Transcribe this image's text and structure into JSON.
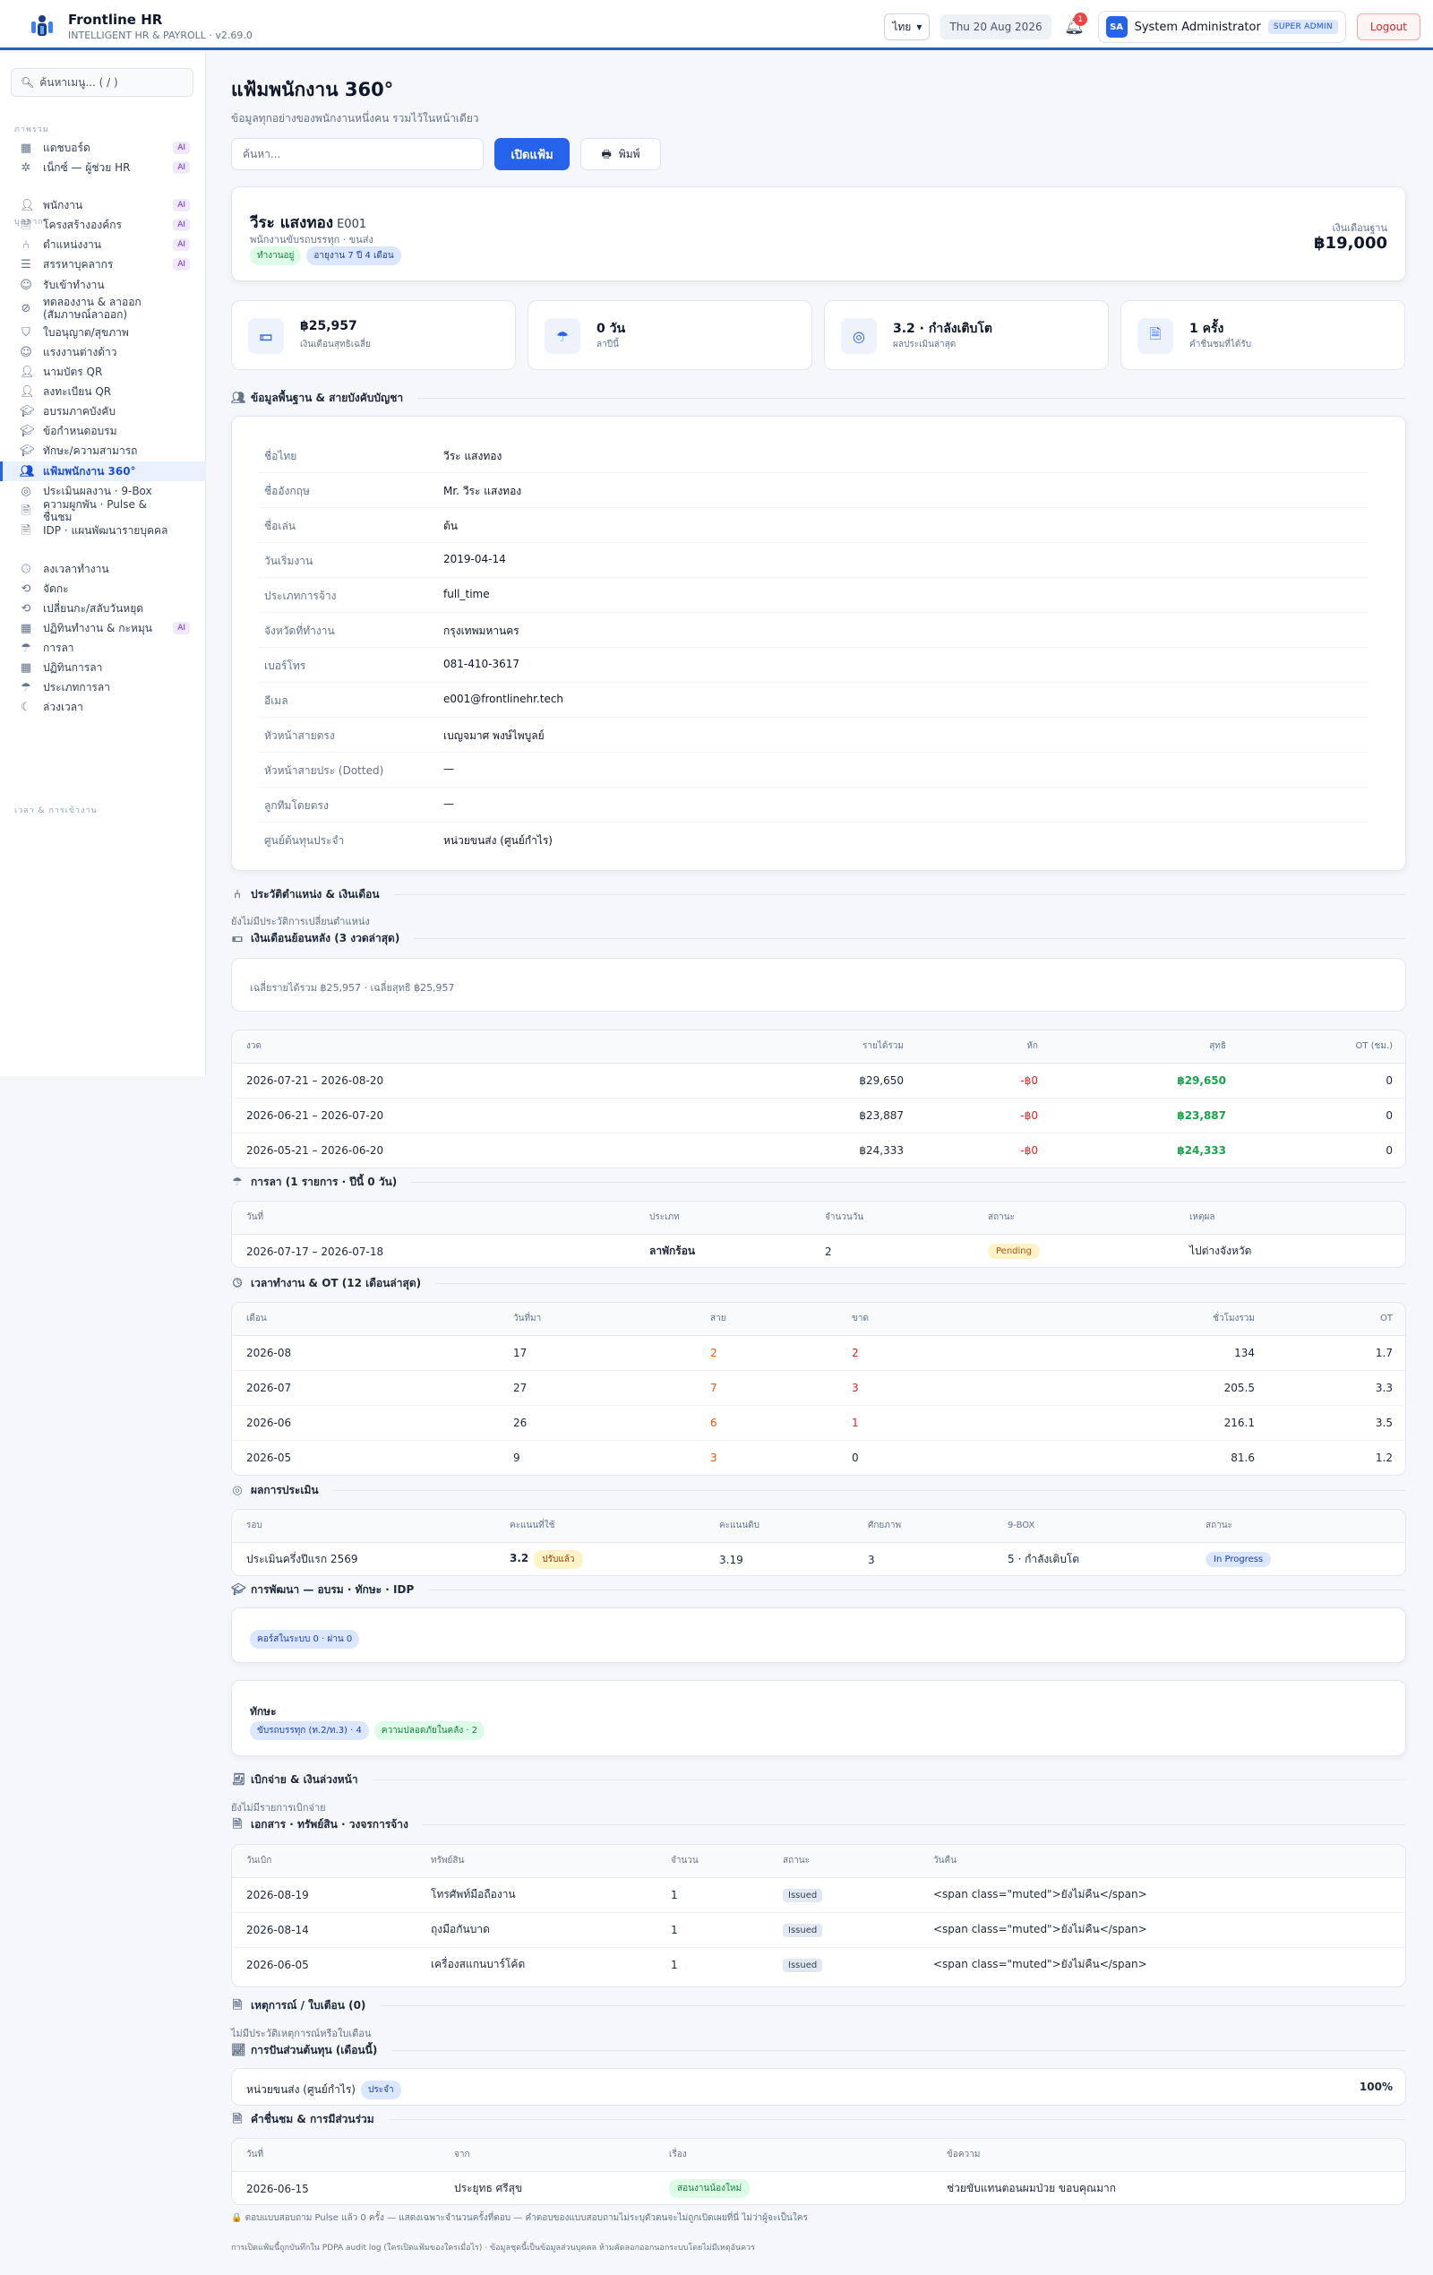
{
  "topbar": {
    "brand_name": "Frontline HR",
    "brand_sub": "INTELLIGENT HR & PAYROLL · v2.69.0",
    "lang": "ไทย",
    "date": "Thu 20 Aug 2026",
    "notif_count": "1",
    "avatar": "SA",
    "user": "System Administrator",
    "role": "SUPER ADMIN",
    "logout": "Logout"
  },
  "sidebar": {
    "search": "ค้นหาเมนู... ( / )",
    "groups": [
      "ภาพรวม",
      "บุคลากร",
      "เวลา & การเข้างาน"
    ],
    "items": [
      {
        "label": "แดชบอร์ด",
        "ai": "AI"
      },
      {
        "label": "เน็กซ์ — ผู้ช่วย HR",
        "ai": "AI"
      },
      {
        "label": "พนักงาน",
        "ai": "AI"
      },
      {
        "label": "โครงสร้างองค์กร",
        "ai": "AI"
      },
      {
        "label": "ตำแหน่งงาน",
        "ai": "AI"
      },
      {
        "label": "สรรหาบุคลากร",
        "ai": "AI"
      },
      {
        "label": "รับเข้าทำงาน"
      },
      {
        "label": "ทดลองงาน & ลาออก (สัมภาษณ์ลาออก)"
      },
      {
        "label": "ใบอนุญาต/สุขภาพ"
      },
      {
        "label": "แรงงานต่างด้าว"
      },
      {
        "label": "นามบัตร QR"
      },
      {
        "label": "ลงทะเบียน QR"
      },
      {
        "label": "อบรมภาคบังคับ"
      },
      {
        "label": "ข้อกำหนดอบรม"
      },
      {
        "label": "ทักษะ/ความสามารถ"
      },
      {
        "label": "แฟ้มพนักงาน 360°"
      },
      {
        "label": "ประเมินผลงาน · 9-Box"
      },
      {
        "label": "ความผูกพัน · Pulse & ชื่นชม"
      },
      {
        "label": "IDP · แผนพัฒนารายบุคคล"
      },
      {
        "label": "ลงเวลาทำงาน"
      },
      {
        "label": "จัดกะ"
      },
      {
        "label": "เปลี่ยนกะ/สลับวันหยุด"
      },
      {
        "label": "ปฏิทินทำงาน & กะหมุน",
        "ai": "AI"
      },
      {
        "label": "การลา"
      },
      {
        "label": "ปฏิทินการลา"
      },
      {
        "label": "ประเภทการลา"
      },
      {
        "label": "ล่วงเวลา"
      }
    ]
  },
  "page": {
    "title": "แฟ้มพนักงาน 360°",
    "subtitle": "ข้อมูลทุกอย่างของพนักงานหนึ่งคน รวมไว้ในหน้าเดียว",
    "search_placeholder": "ค้นหา...",
    "open_btn": "เปิดแฟ้ม",
    "print_btn": "พิมพ์"
  },
  "profile": {
    "name": "วีระ แสงทอง",
    "code": "E001",
    "position": "พนักงานขับรถบรรทุก · ขนส่ง",
    "status": "ทำงานอยู่",
    "tenure": "อายุงาน 7 ปี 4 เดือน",
    "salary_label": "เงินเดือนฐาน",
    "salary": "฿19,000"
  },
  "kpis": [
    {
      "value": "฿25,957",
      "label": "เงินเดือนสุทธิเฉลี่ย",
      "icon": "money-icon"
    },
    {
      "value": "0 วัน",
      "label": "ลาปีนี้",
      "icon": "umbrella-icon"
    },
    {
      "value": "3.2 · กำลังเติบโต",
      "label": "ผลประเมินล่าสุด",
      "icon": "target-icon"
    },
    {
      "value": "1 ครั้ง",
      "label": "คำชื่นชมที่ได้รับ",
      "icon": "document-icon"
    }
  ],
  "basic": {
    "heading": "ข้อมูลพื้นฐาน & สายบังคับบัญชา",
    "rows": [
      {
        "k": "ชื่อไทย",
        "v": "วีระ แสงทอง"
      },
      {
        "k": "ชื่ออังกฤษ",
        "v": "Mr. วีระ แสงทอง"
      },
      {
        "k": "ชื่อเล่น",
        "v": "ต้น"
      },
      {
        "k": "วันเริ่มงาน",
        "v": "2019-04-14"
      },
      {
        "k": "ประเภทการจ้าง",
        "v": "full_time"
      },
      {
        "k": "จังหวัดที่ทำงาน",
        "v": "กรุงเทพมหานคร"
      },
      {
        "k": "เบอร์โทร",
        "v": "081-410-3617"
      },
      {
        "k": "อีเมล",
        "v": "e001@frontlinehr.tech"
      },
      {
        "k": "หัวหน้าสายตรง",
        "v": "เบญจมาศ พงษ์ไพบูลย์"
      },
      {
        "k": "หัวหน้าสายประ (Dotted)",
        "v": "—"
      },
      {
        "k": "ลูกทีมโดยตรง",
        "v": "—"
      },
      {
        "k": "ศูนย์ต้นทุนประจำ",
        "v": "หน่วยขนส่ง (ศูนย์กำไร)"
      }
    ]
  },
  "position_history": {
    "heading": "ประวัติตำแหน่ง & เงินเดือน",
    "empty": "ยังไม่มีประวัติการเปลี่ยนตำแหน่ง"
  },
  "payroll": {
    "heading": "เงินเดือนย้อนหลัง (3 งวดล่าสุด)",
    "summary": "เฉลี่ยรายได้รวม ฿25,957 · เฉลี่ยสุทธิ ฿25,957",
    "cols": [
      "งวด",
      "รายได้รวม",
      "หัก",
      "สุทธิ",
      "OT (ชม.)"
    ],
    "rows": [
      {
        "period": "2026-07-21 – 2026-08-20",
        "gross": "฿29,650",
        "ded": "-฿0",
        "net": "฿29,650",
        "ot": "0"
      },
      {
        "period": "2026-06-21 – 2026-07-20",
        "gross": "฿23,887",
        "ded": "-฿0",
        "net": "฿23,887",
        "ot": "0"
      },
      {
        "period": "2026-05-21 – 2026-06-20",
        "gross": "฿24,333",
        "ded": "-฿0",
        "net": "฿24,333",
        "ot": "0"
      }
    ]
  },
  "leave": {
    "heading": "การลา (1 รายการ · ปีนี้ 0 วัน)",
    "cols": [
      "วันที่",
      "ประเภท",
      "จำนวนวัน",
      "สถานะ",
      "เหตุผล"
    ],
    "rows": [
      {
        "date": "2026-07-17 – 2026-07-18",
        "type": "ลาพักร้อน",
        "days": "2",
        "status": "Pending",
        "reason": "ไปต่างจังหวัด"
      }
    ]
  },
  "attendance": {
    "heading": "เวลาทำงาน & OT (12 เดือนล่าสุด)",
    "cols": [
      "เดือน",
      "วันที่มา",
      "สาย",
      "ขาด",
      "ชั่วโมงรวม",
      "OT"
    ],
    "rows": [
      {
        "m": "2026-08",
        "days": "17",
        "late": "2",
        "absent": "2",
        "hours": "134",
        "ot": "1.7"
      },
      {
        "m": "2026-07",
        "days": "27",
        "late": "7",
        "absent": "3",
        "hours": "205.5",
        "ot": "3.3"
      },
      {
        "m": "2026-06",
        "days": "26",
        "late": "6",
        "absent": "1",
        "hours": "216.1",
        "ot": "3.5"
      },
      {
        "m": "2026-05",
        "days": "9",
        "late": "3",
        "absent": "0",
        "hours": "81.6",
        "ot": "1.2"
      }
    ]
  },
  "evaluation": {
    "heading": "ผลการประเมิน",
    "cols": [
      "รอบ",
      "คะแนนที่ใช้",
      "คะแนนดิบ",
      "ศักยภาพ",
      "9-BOX",
      "สถานะ"
    ],
    "rows": [
      {
        "round": "ประเมินครึ่งปีแรก 2569",
        "score": "3.2",
        "adj": "ปรับแล้ว",
        "raw": "3.19",
        "pot": "3",
        "box": "5 · กำลังเติบโต",
        "status": "In Progress"
      }
    ]
  },
  "development": {
    "heading": "การพัฒนา — อบรม · ทักษะ · IDP",
    "courses": "คอร์สในระบบ 0 · ผ่าน 0",
    "skills_title": "ทักษะ",
    "skills": [
      "ขับรถบรรทุก (ท.2/ท.3) · 4",
      "ความปลอดภัยในคลัง · 2"
    ]
  },
  "expense": {
    "heading": "เบิกจ่าย & เงินล่วงหน้า",
    "empty": "ยังไม่มีรายการเบิกจ่าย"
  },
  "assets": {
    "heading": "เอกสาร · ทรัพย์สิน · วงจรการจ้าง",
    "cols": [
      "วันเบิก",
      "ทรัพย์สิน",
      "จำนวน",
      "สถานะ",
      "วันคืน"
    ],
    "rows": [
      {
        "date": "2026-08-19",
        "asset": "โทรศัพท์มือถืองาน",
        "qty": "1",
        "status": "Issued",
        "ret": "<span class=\"muted\">ยังไม่คืน</span>"
      },
      {
        "date": "2026-08-14",
        "asset": "ถุงมือกันบาด",
        "qty": "1",
        "status": "Issued",
        "ret": "<span class=\"muted\">ยังไม่คืน</span>"
      },
      {
        "date": "2026-06-05",
        "asset": "เครื่องสแกนบาร์โค้ด",
        "qty": "1",
        "status": "Issued",
        "ret": "<span class=\"muted\">ยังไม่คืน</span>"
      }
    ]
  },
  "incidents": {
    "heading": "เหตุการณ์ / ใบเตือน (0)",
    "empty": "ไม่มีประวัติเหตุการณ์หรือใบเตือน"
  },
  "cost": {
    "heading": "การปันส่วนต้นทุน (เดือนนี้)",
    "unit": "หน่วยขนส่ง (ศูนย์กำไร)",
    "tag": "ประจำ",
    "pct": "100%"
  },
  "praise": {
    "heading": "คำชื่นชม & การมีส่วนร่วม",
    "cols": [
      "วันที่",
      "จาก",
      "เรื่อง",
      "ข้อความ"
    ],
    "rows": [
      {
        "date": "2026-06-15",
        "from": "ประยุทธ ศรีสุข",
        "topic": "สอนงานน้องใหม่",
        "msg": "ช่วยขับแทนตอนผมป่วย ขอบคุณมาก"
      }
    ]
  },
  "footer": {
    "pulse": "🔒 ตอบแบบสอบถาม Pulse แล้ว 0 ครั้ง — แสดงเฉพาะจำนวนครั้งที่ตอบ — คำตอบของแบบสอบถามไม่ระบุตัวตนจะไม่ถูกเปิดเผยที่นี่ ไม่ว่าผู้จะเป็นใคร",
    "audit": "การเปิดแฟ้มนี้ถูกบันทึกใน PDPA audit log (ใครเปิดแฟ้มของใครเมื่อไร) · ข้อมูลชุดนี้เป็นข้อมูลส่วนบุคคล ห้ามคัดลอกออกนอกระบบโดยไม่มีเหตุอันควร"
  }
}
